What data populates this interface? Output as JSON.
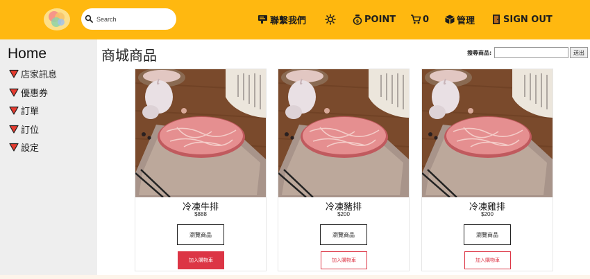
{
  "header": {
    "search_placeholder": "Search",
    "nav": {
      "contact": "聯繫我們",
      "point": "POINT",
      "cart_count": "0",
      "manage": "管理",
      "sign_out": "SIGN OUT"
    },
    "colors": {
      "bar": "#ffb810"
    }
  },
  "sidebar": {
    "home": "Home",
    "items": [
      {
        "label": "店家訊息"
      },
      {
        "label": "優惠券"
      },
      {
        "label": "訂單"
      },
      {
        "label": "訂位"
      },
      {
        "label": "設定"
      }
    ]
  },
  "main": {
    "title": "商城商品",
    "search_label": "搜尋商品:",
    "search_value": "",
    "search_button": "送出",
    "products": [
      {
        "name": "冷凍牛排",
        "price": "$888",
        "view_label": "瀏覽商品",
        "cart_label": "加入購物車",
        "cart_style": "solid"
      },
      {
        "name": "冷凍豬排",
        "price": "$200",
        "view_label": "瀏覽商品",
        "cart_label": "加入購物車",
        "cart_style": "outline"
      },
      {
        "name": "冷凍雞排",
        "price": "$200",
        "view_label": "瀏覽商品",
        "cart_label": "加入購物車",
        "cart_style": "outline"
      }
    ]
  }
}
